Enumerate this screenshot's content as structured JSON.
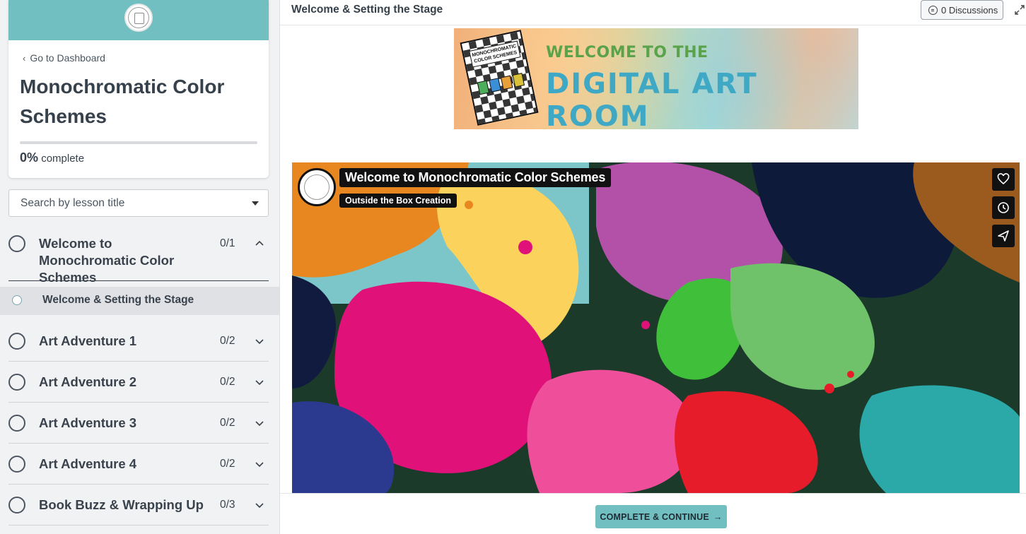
{
  "sidebar": {
    "back_link": "Go to Dashboard",
    "course_title": "Monochromatic Color Schemes",
    "progress_percent": "0%",
    "progress_value": 0,
    "progress_suffix": "complete",
    "search_placeholder": "Search by lesson title",
    "sections": [
      {
        "label": "Welcome to Monochromatic Color Schemes",
        "count": "0/1",
        "expanded": true
      },
      {
        "label": "Art Adventure 1",
        "count": "0/2",
        "expanded": false
      },
      {
        "label": "Art Adventure 2",
        "count": "0/2",
        "expanded": false
      },
      {
        "label": "Art Adventure 3",
        "count": "0/2",
        "expanded": false
      },
      {
        "label": "Art Adventure 4",
        "count": "0/2",
        "expanded": false
      },
      {
        "label": "Book Buzz & Wrapping Up",
        "count": "0/3",
        "expanded": false
      }
    ],
    "active_lesson": "Welcome & Setting the Stage"
  },
  "header": {
    "lesson_title": "Welcome & Setting the Stage",
    "discussions_label": "0 Discussions"
  },
  "banner": {
    "line1": "WELCOME TO THE",
    "line2": "DIGITAL ART ROOM",
    "book_title": "MONOCHROMATIC COLOR SCHEMES"
  },
  "video": {
    "title": "Welcome to Monochromatic Color Schemes",
    "channel": "Outside the Box Creation"
  },
  "footer": {
    "complete_label": "COMPLETE & CONTINUE"
  },
  "colors": {
    "accent": "#72bfc1",
    "sidebar_bg": "#f1f2f4",
    "text": "#37414b"
  }
}
